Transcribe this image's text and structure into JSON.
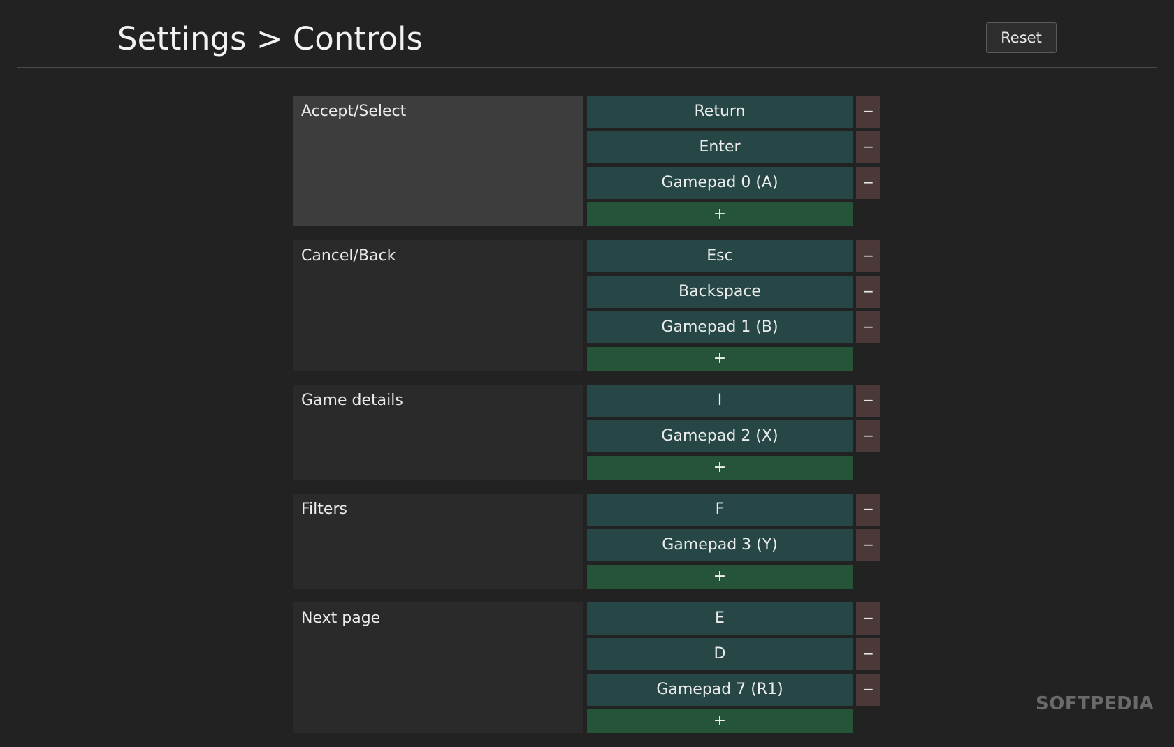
{
  "header": {
    "title": "Settings > Controls",
    "reset_label": "Reset"
  },
  "controls": [
    {
      "action": "Accept/Select",
      "selected": true,
      "bindings": [
        "Return",
        "Enter",
        "Gamepad 0 (A)"
      ],
      "add_label": "+"
    },
    {
      "action": "Cancel/Back",
      "selected": false,
      "bindings": [
        "Esc",
        "Backspace",
        "Gamepad 1 (B)"
      ],
      "add_label": "+"
    },
    {
      "action": "Game details",
      "selected": false,
      "bindings": [
        "I",
        "Gamepad 2 (X)"
      ],
      "add_label": "+"
    },
    {
      "action": "Filters",
      "selected": false,
      "bindings": [
        "F",
        "Gamepad 3 (Y)"
      ],
      "add_label": "+"
    },
    {
      "action": "Next page",
      "selected": false,
      "bindings": [
        "E",
        "D",
        "Gamepad 7 (R1)"
      ],
      "add_label": "+"
    }
  ],
  "remove_label": "−",
  "watermark": "SOFTPEDIA",
  "colors": {
    "background": "#222222",
    "binding_key": "#274747",
    "remove_button": "#4b3838",
    "add_button": "#265439",
    "label_selected": "#3d3d3d",
    "label_normal": "#2a2a2a"
  },
  "icons": {
    "remove": "minus-icon",
    "add": "plus-icon"
  }
}
